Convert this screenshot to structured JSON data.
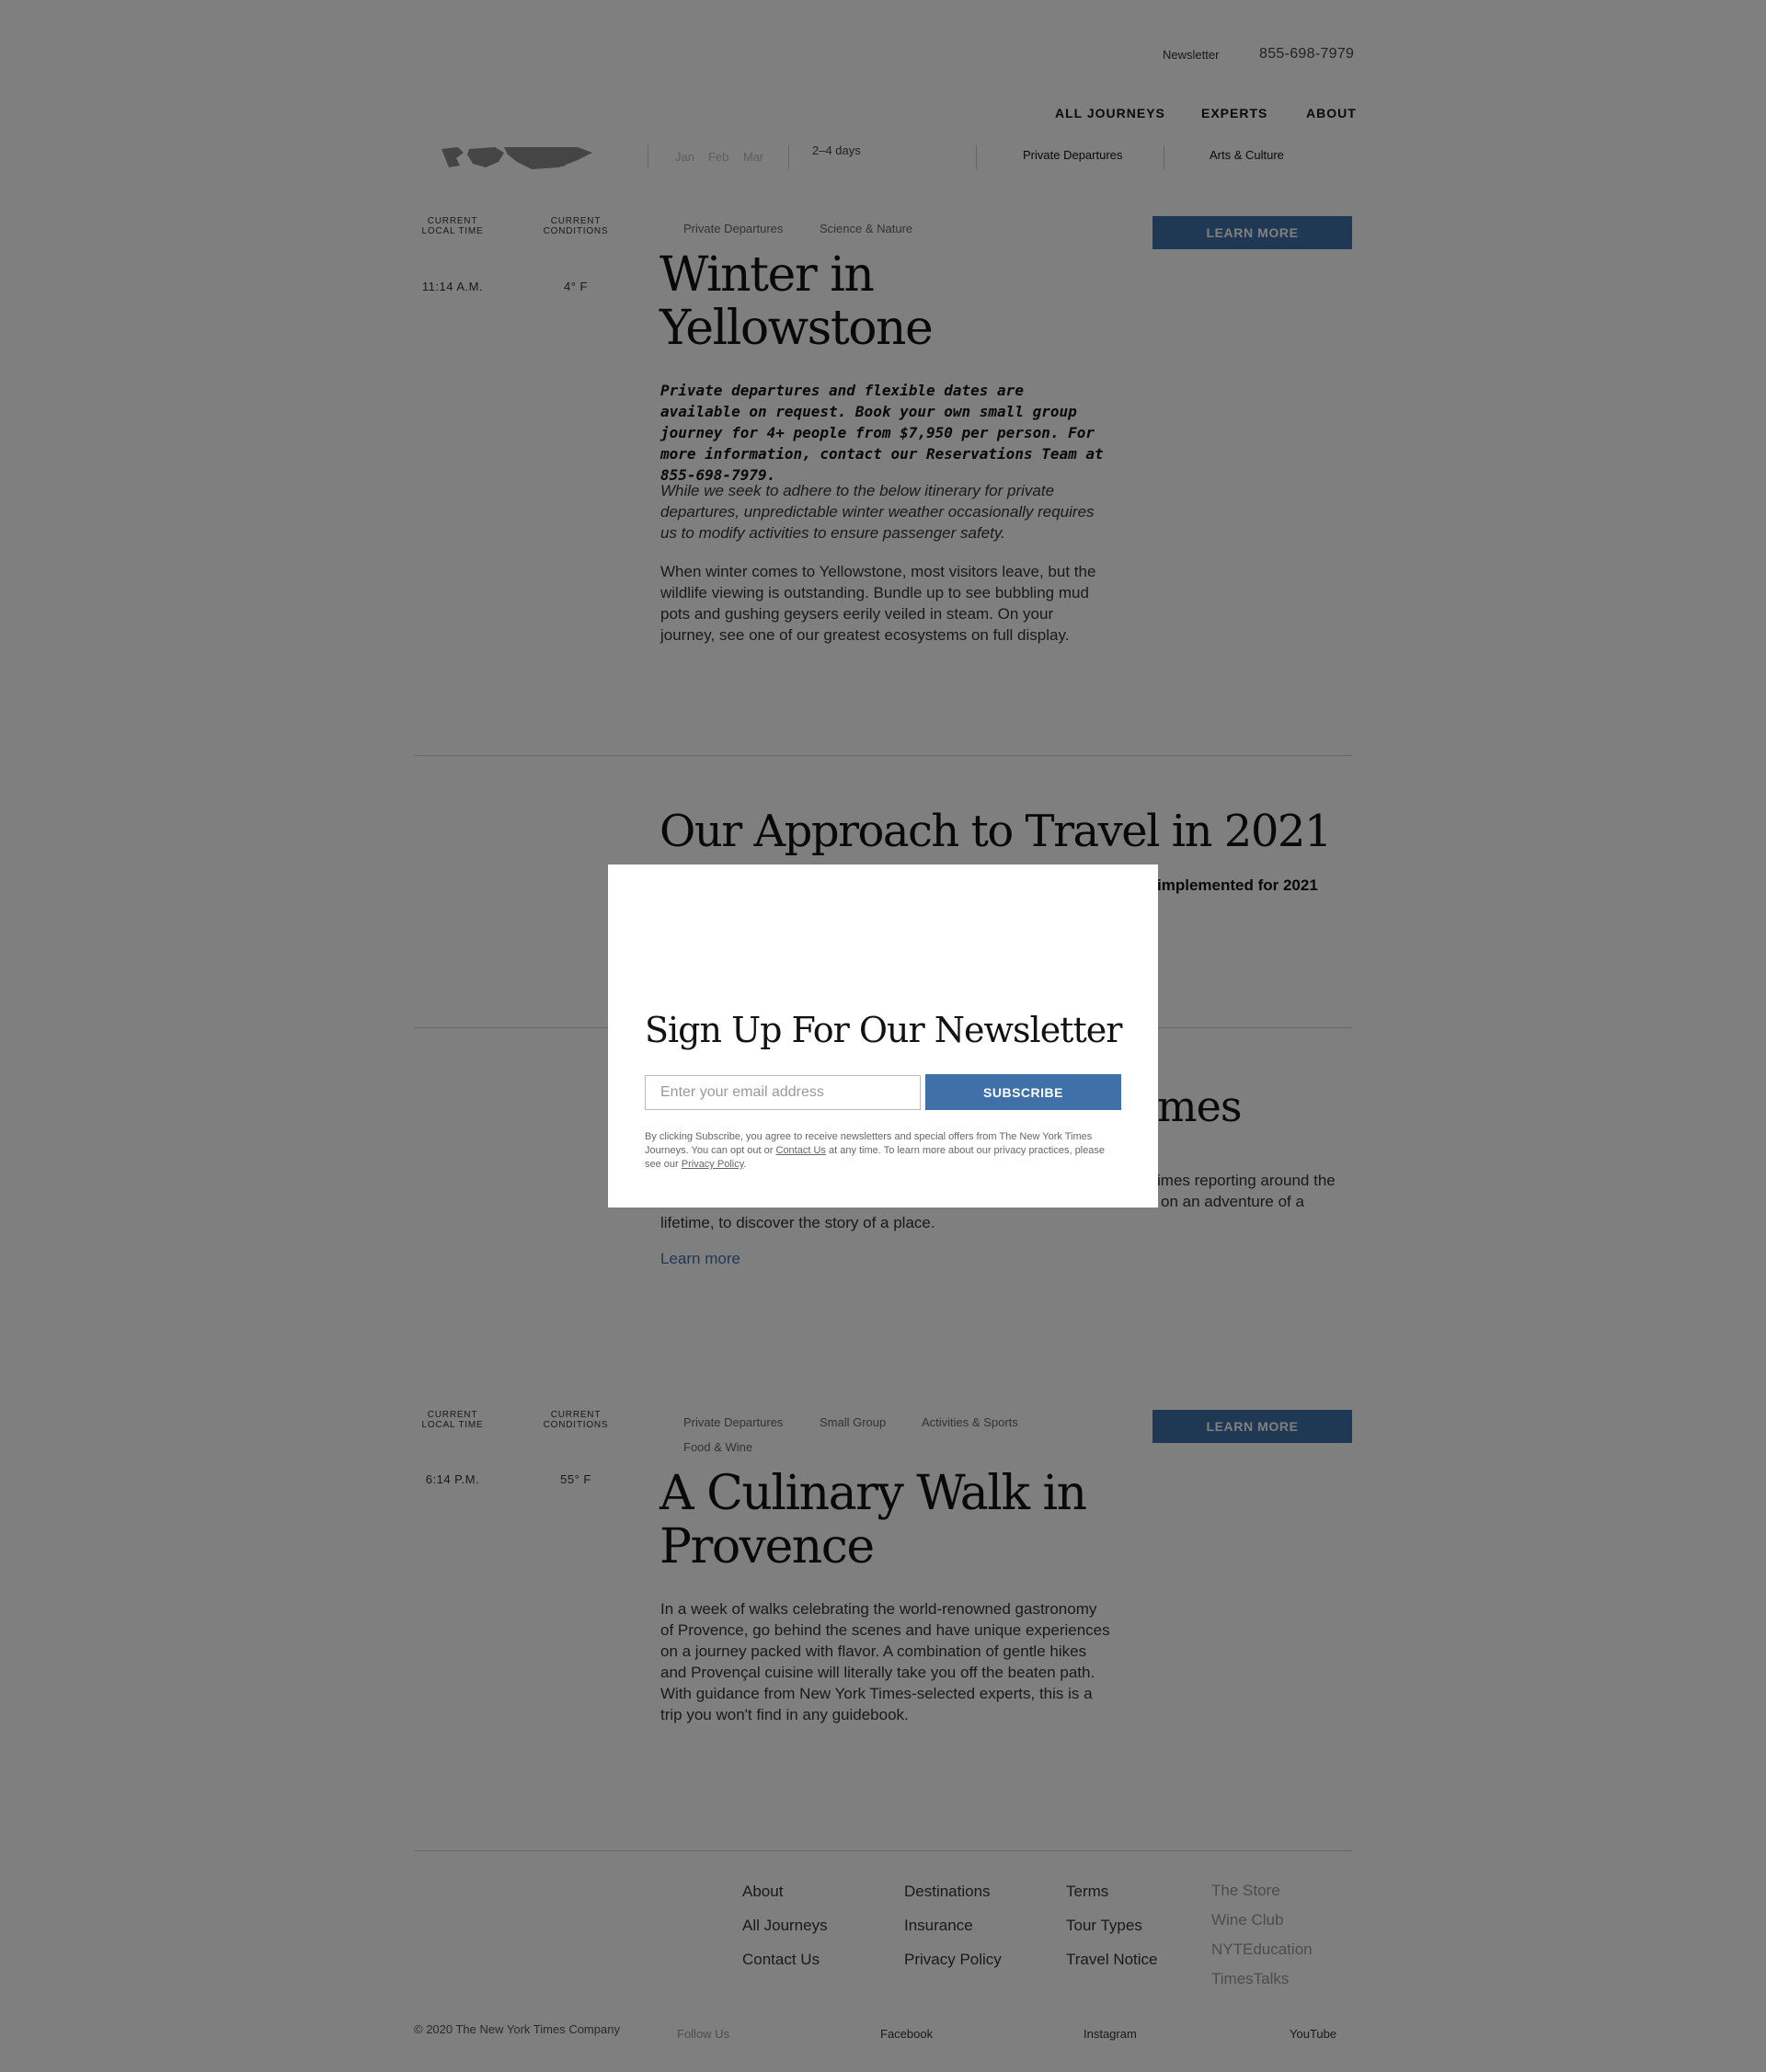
{
  "header": {
    "newsletter_link": "Newsletter",
    "phone": "855-698-7979",
    "nav": [
      "ALL JOURNEYS",
      "EXPERTS",
      "ABOUT"
    ]
  },
  "filters": {
    "months": [
      "Jan",
      "Feb",
      "Mar"
    ],
    "duration": "2–4 days",
    "departure_type": "Private Departures",
    "interest": "Arts & Culture"
  },
  "trip1": {
    "local_time_label": "CURRENT LOCAL TIME",
    "conditions_label": "CURRENT CONDITIONS",
    "local_time": "11:14 A.M.",
    "conditions": "4° F",
    "tags": [
      "Private Departures",
      "Science & Nature"
    ],
    "learn_more": "LEARN MORE",
    "title_line1": "Winter in",
    "title_line2": "Yellowstone",
    "bold_para": "Private departures and flexible dates are available on request. Book your own small group journey for 4+ people from $7,950 per person. For more information, contact our Reservations Team at  855-698-7979.",
    "italic_para": "While we seek to adhere to the below itinerary for private departures, unpredictable winter weather occasionally requires us to modify activities to ensure passenger safety.",
    "body_para": "When winter comes to Yellowstone, most visitors leave, but the wildlife viewing is outstanding. Bundle up to see bubbling mud pots and gushing geysers eerily veiled in steam. On your journey, see one of our greatest ecosystems on full display."
  },
  "approach": {
    "title": "Our Approach to Travel in 2021",
    "partial_text": "implemented for 2021"
  },
  "times_section": {
    "title_fragment": "mes",
    "para_line1_fragment": "imes reporting around the",
    "para_line2_fragment": "on an adventure of a",
    "para_line3": "lifetime, to discover the story of a place.",
    "learn_more_link": "Learn more"
  },
  "trip2": {
    "local_time_label": "CURRENT LOCAL TIME",
    "conditions_label": "CURRENT CONDITIONS",
    "local_time": "6:14 P.M.",
    "conditions": "55° F",
    "tags": [
      "Private Departures",
      "Small Group",
      "Activities & Sports",
      "Food & Wine"
    ],
    "learn_more": "LEARN MORE",
    "title_line1": "A Culinary Walk in",
    "title_line2": "Provence",
    "body_para": "In a week of walks celebrating the world-renowned gastronomy of Provence, go behind the scenes and have unique experiences on a journey packed with flavor. A combination of gentle hikes and Provençal cuisine will literally take you off the beaten path. With guidance from New York Times-selected experts, this is a trip you won't find in any guidebook."
  },
  "footer": {
    "col1": [
      "About",
      "All Journeys",
      "Contact Us"
    ],
    "col2": [
      "Destinations",
      "Insurance",
      "Privacy Policy"
    ],
    "col3": [
      "Terms",
      "Tour Types",
      "Travel Notice"
    ],
    "col4": [
      "The Store",
      "Wine Club",
      "NYTEducation",
      "TimesTalks"
    ],
    "copyright": "© 2020 The New York Times Company",
    "follow_us": "Follow Us",
    "social": [
      "Facebook",
      "Instagram",
      "YouTube"
    ]
  },
  "modal": {
    "title": "Sign Up For Our Newsletter",
    "email_placeholder": "Enter your email address",
    "subscribe_label": "SUBSCRIBE",
    "legal_part1": "By clicking Subscribe, you agree to receive newsletters and special offers from The New York Times Journeys. You can opt out or ",
    "legal_contact_link": "Contact Us",
    "legal_part2": " at any time. To learn more about our privacy practices, please see our ",
    "legal_privacy_link": "Privacy Policy",
    "legal_part3": "."
  }
}
